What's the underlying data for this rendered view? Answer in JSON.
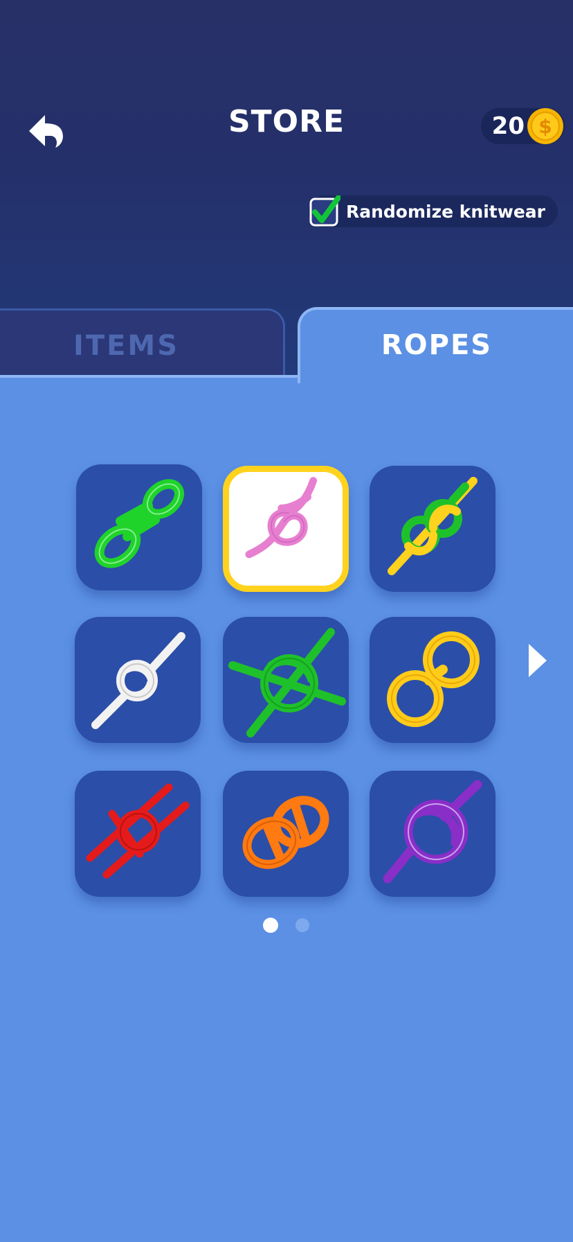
{
  "header": {
    "title": "STORE",
    "coins": "20",
    "colors": {
      "background": "#283068",
      "coin": "#f7b500"
    }
  },
  "randomize": {
    "label": "Randomize knitwear",
    "checked": true
  },
  "tabs": [
    {
      "label": "ITEMS",
      "active": false
    },
    {
      "label": "ROPES",
      "active": true
    }
  ],
  "ropes": [
    {
      "color": "#1fd32a",
      "icon": "coiled-rope-icon",
      "selected": false
    },
    {
      "color": "#e77fd0",
      "icon": "loop-knot-icon",
      "selected": true
    },
    {
      "color": "#ffd21e",
      "icon": "figure-eight-knot-icon",
      "selected": false
    },
    {
      "color": "#f2f2f2",
      "icon": "overhand-knot-icon",
      "selected": false
    },
    {
      "color": "#1fc12a",
      "icon": "cross-knot-icon",
      "selected": false
    },
    {
      "color": "#ffcc1a",
      "icon": "infinity-loop-icon",
      "selected": false
    },
    {
      "color": "#e51b1b",
      "icon": "double-cross-knot-icon",
      "selected": false
    },
    {
      "color": "#ff7a10",
      "icon": "chain-loop-icon",
      "selected": false
    },
    {
      "color": "#8a2ec8",
      "icon": "round-knot-icon",
      "selected": false
    }
  ],
  "pagination": {
    "current_page": 1,
    "total_pages": 2
  }
}
